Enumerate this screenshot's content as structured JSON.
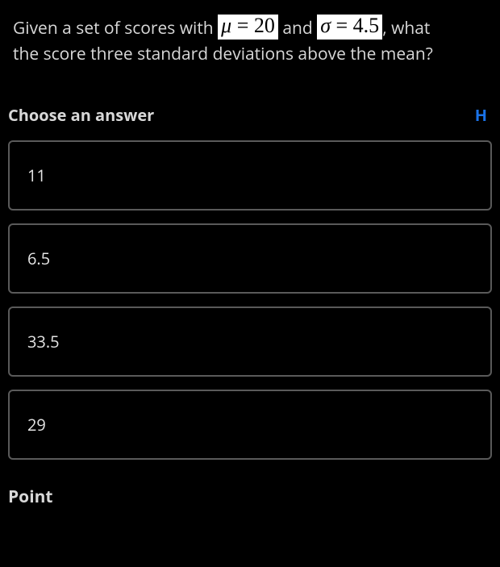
{
  "question": {
    "prefix": "Given a set of scores with ",
    "formula1_var": "μ",
    "formula1_eq": " = 20",
    "mid1": " and ",
    "formula2_var": "σ",
    "formula2_eq": " = 4.5",
    "mid2": ", what",
    "line2": "the score three standard deviations above the mean?"
  },
  "choose_label": "Choose an answer",
  "hint_label": "H",
  "answers": [
    {
      "text": "11"
    },
    {
      "text": "6.5"
    },
    {
      "text": "33.5"
    },
    {
      "text": "29"
    }
  ],
  "point_label": "Point"
}
